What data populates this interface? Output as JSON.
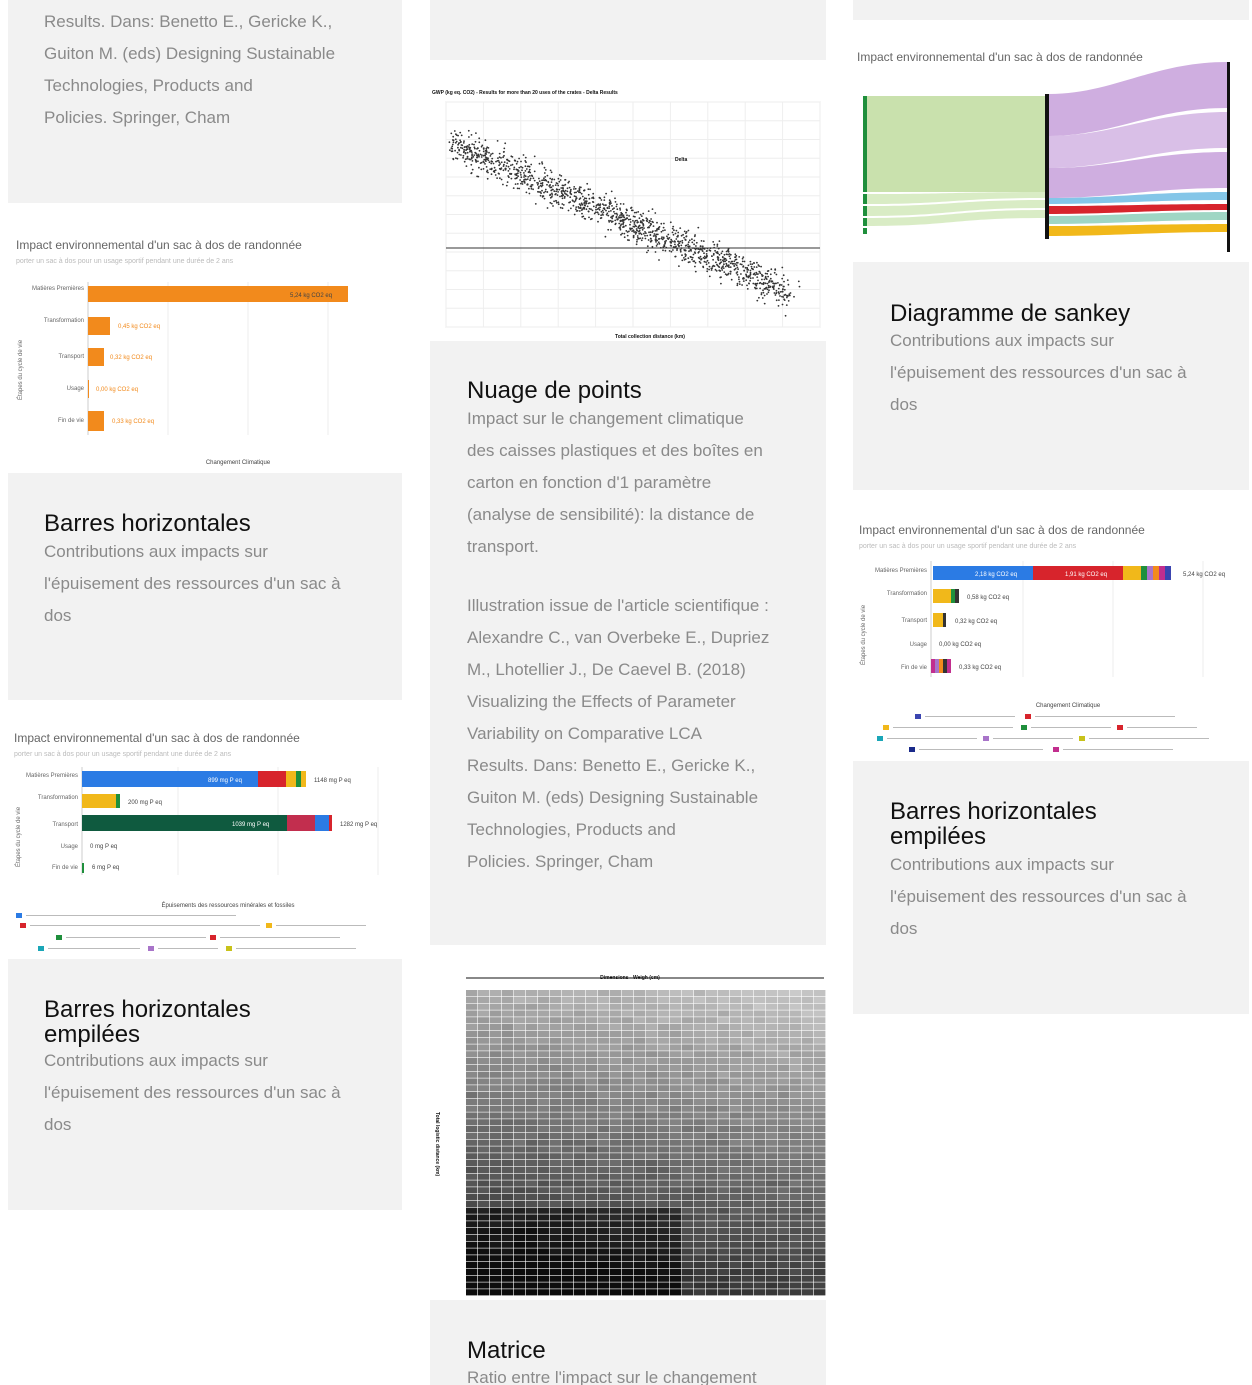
{
  "cards": {
    "top_left": {
      "desc": "Results. Dans: Benetto E., Gericke K.,\nGuiton M. (eds) Designing Sustainable\nTechnologies, Products and\nPolicies. Springer, Cham"
    },
    "barres1": {
      "title": "Barres horizontales",
      "desc": "Contributions aux impacts sur\nl'épuisement des ressources d'un sac à\ndos",
      "thumb_title": "Impact environnemental d'un sac à dos de randonnée",
      "thumb_sub": "porter un sac à dos pour un usage sportif pendant une durée de 2 ans",
      "ylabel": "Étapes du cycle de vie",
      "xlabel": "Changement Climatique",
      "bars": [
        {
          "label": "Matières Premières",
          "value": "5,24 kg CO2 eq"
        },
        {
          "label": "Transformation",
          "value": "0,45 kg CO2 eq"
        },
        {
          "label": "Transport",
          "value": "0,32 kg CO2 eq"
        },
        {
          "label": "Usage",
          "value": "0,00 kg CO2 eq"
        },
        {
          "label": "Fin de vie",
          "value": "0,33 kg CO2 eq"
        }
      ]
    },
    "barres_empilees1": {
      "title": "Barres horizontales\nempilées",
      "desc": "Contributions aux impacts sur\nl'épuisement des ressources d'un sac à\ndos",
      "thumb_title": "Impact environnemental d'un sac à dos de randonnée",
      "thumb_sub": "porter un sac à dos pour un usage sportif pendant une durée de 2 ans",
      "ylabel": "Étapes du cycle de vie",
      "xlabel": "Épuisements des ressources minérales et fossiles",
      "bars": [
        {
          "label": "Matières Premières",
          "inner": "899 mg P eq",
          "value": "1148 mg P eq"
        },
        {
          "label": "Transformation",
          "inner": "",
          "value": "200 mg P eq"
        },
        {
          "label": "Transport",
          "inner": "1039 mg P eq",
          "value": "1282 mg P eq"
        },
        {
          "label": "Usage",
          "inner": "",
          "value": "0 mg P eq"
        },
        {
          "label": "Fin de vie",
          "inner": "",
          "value": "6 mg P eq"
        }
      ]
    },
    "nuage": {
      "title": "Nuage de points",
      "desc": "Impact sur le changement climatique\ndes caisses plastiques et des boîtes en\ncarton en fonction d'1 paramètre\n(analyse de sensibilité): la distance de\ntransport.",
      "desc2": "Illustration issue de l'article scientifique :\nAlexandre C., van Overbeke E., Dupriez\nM., Lhotellier J., De Caevel B. (2018)\nVisualizing the Effects of Parameter\nVariability on Comparative LCA\nResults. Dans: Benetto E., Gericke K.,\nGuiton M. (eds) Designing Sustainable\nTechnologies, Products and\nPolicies. Springer, Cham",
      "thumb_title": "GWP (kg eq. CO2) - Results for more than 20 uses of the crates - Delta Results",
      "xlabel": "Total collection distance (km)",
      "annotation": "Delta"
    },
    "matrice": {
      "title": "Matrice",
      "desc": "Ratio entre l'impact sur le changement",
      "col_header": "Dimensions - Weigh (cm)",
      "row_header": "Total logistic distance (km)"
    },
    "sankey": {
      "title": "Diagramme de sankey",
      "desc": "Contributions aux impacts sur\nl'épuisement des ressources d'un sac à\ndos",
      "thumb_title": "Impact environnemental d'un sac à dos de randonnée"
    },
    "barres_empilees2": {
      "title": "Barres horizontales\nempilées",
      "desc": "Contributions aux impacts sur\nl'épuisement des ressources d'un sac à\ndos",
      "thumb_title": "Impact environnemental d'un sac à dos de randonnée",
      "thumb_sub": "porter un sac à dos pour un usage sportif pendant une durée de 2 ans",
      "ylabel": "Étapes du cycle de vie",
      "xlabel": "Changement Climatique",
      "bars": [
        {
          "label": "Matières Premières",
          "inner1": "2,18 kg CO2 eq",
          "inner2": "1,91 kg CO2 eq",
          "value": "5,24 kg CO2 eq"
        },
        {
          "label": "Transformation",
          "value": "0,58 kg CO2 eq"
        },
        {
          "label": "Transport",
          "value": "0,32 kg CO2 eq"
        },
        {
          "label": "Usage",
          "value": "0,00 kg CO2 eq"
        },
        {
          "label": "Fin de vie",
          "value": "0,33 kg CO2 eq"
        }
      ]
    }
  },
  "colors": {
    "card_bg": "#f2f2f2",
    "orange": "#f28a1c",
    "blue": "#2b7be4",
    "red": "#d7242c",
    "yellow": "#f1b81a",
    "green": "#1f8f3c",
    "darkgreen": "#0f5a3f",
    "purple": "#a874c9",
    "sankey_green": "#c9e1ad"
  }
}
